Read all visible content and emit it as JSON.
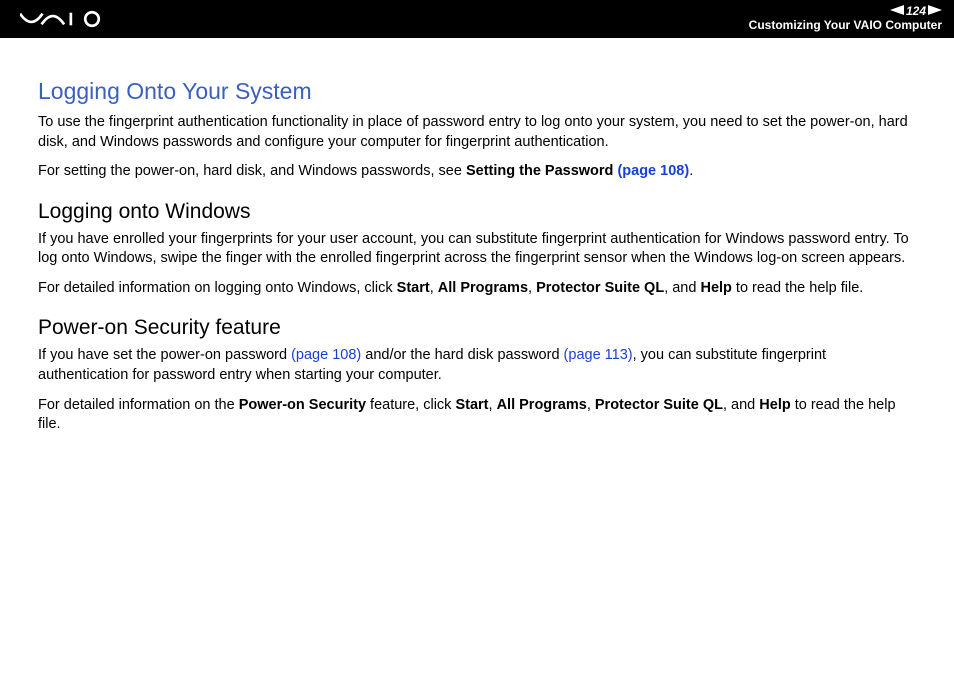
{
  "header": {
    "page_number": "124",
    "section": "Customizing Your VAIO Computer"
  },
  "content": {
    "title": "Logging Onto Your System",
    "p1": "To use the fingerprint authentication functionality in place of password entry to log onto your system, you need to set the power-on, hard disk, and Windows passwords and configure your computer for fingerprint authentication.",
    "p2_a": "For setting the power-on, hard disk, and Windows passwords, see ",
    "p2_b": "Setting the Password ",
    "p2_link": "(page 108)",
    "p2_c": ".",
    "h2a": "Logging onto Windows",
    "p3": "If you have enrolled your fingerprints for your user account, you can substitute fingerprint authentication for Windows password entry. To log onto Windows, swipe the finger with the enrolled fingerprint across the fingerprint sensor when the Windows log-on screen appears.",
    "p4_a": "For detailed information on logging onto Windows, click ",
    "p4_start": "Start",
    "p4_sep1": ", ",
    "p4_all": "All Programs",
    "p4_sep2": ", ",
    "p4_psql": "Protector Suite QL",
    "p4_sep3": ", and ",
    "p4_help": "Help",
    "p4_b": " to read the help file.",
    "h2b": "Power-on Security feature",
    "p5_a": "If you have set the power-on password ",
    "p5_link1": "(page 108)",
    "p5_b": " and/or the hard disk password ",
    "p5_link2": "(page 113)",
    "p5_c": ", you can substitute fingerprint authentication for password entry when starting your computer.",
    "p6_a": "For detailed information on the ",
    "p6_pos": "Power-on Security",
    "p6_b": " feature, click ",
    "p6_start": "Start",
    "p6_sep1": ", ",
    "p6_all": "All Programs",
    "p6_sep2": ", ",
    "p6_psql": "Protector Suite QL",
    "p6_sep3": ", and ",
    "p6_help": "Help",
    "p6_c": " to read the help file."
  }
}
